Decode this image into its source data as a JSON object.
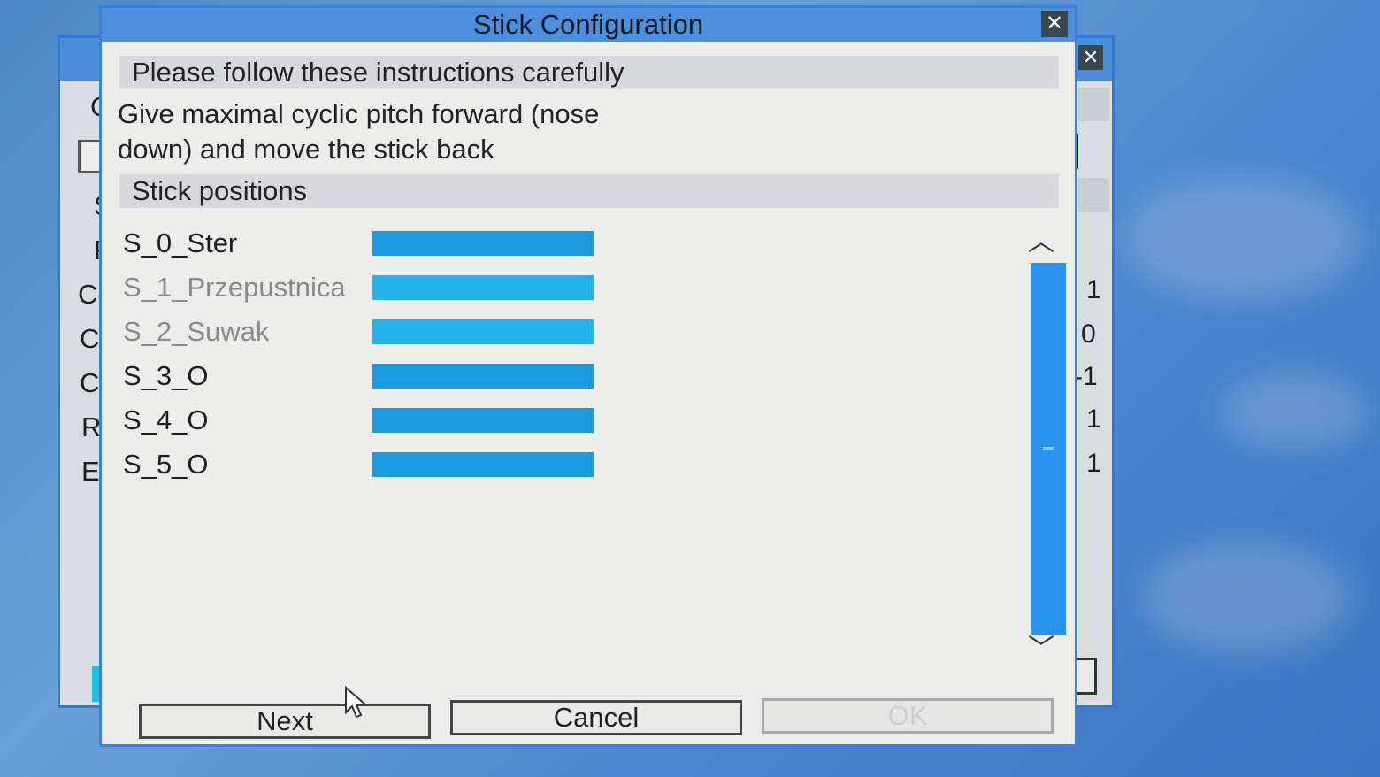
{
  "background_window": {
    "close_icon": "close-icon",
    "labels": [
      "C",
      "S",
      "F",
      "Co",
      "Cy",
      "Cy",
      "Ru",
      "En"
    ],
    "values": [
      "1",
      "0",
      "-1",
      "1",
      "1"
    ]
  },
  "dialog": {
    "title": "Stick Configuration",
    "close_icon": "close-icon",
    "instructions_header": "Please follow these instructions carefully",
    "instruction_line1": "Give maximal cyclic pitch forward (nose",
    "instruction_line2": "down) and move the stick back",
    "stick_positions_header": "Stick positions",
    "sticks": [
      {
        "label": "S_0_Ster"
      },
      {
        "label": "S_1_Przepustnica"
      },
      {
        "label": "S_2_Suwak"
      },
      {
        "label": "S_3_O"
      },
      {
        "label": "S_4_O"
      },
      {
        "label": "S_5_O"
      }
    ],
    "scroll_up_icon": "chevron-up-icon",
    "scroll_down_icon": "chevron-down-icon",
    "buttons": {
      "next": "Next",
      "cancel": "Cancel",
      "ok": "OK"
    }
  },
  "colors": {
    "accent": "#4a90dc",
    "bar": "#1c9ae0",
    "bar_light": "#22b3ea",
    "scrollbar": "#2a93ee"
  }
}
